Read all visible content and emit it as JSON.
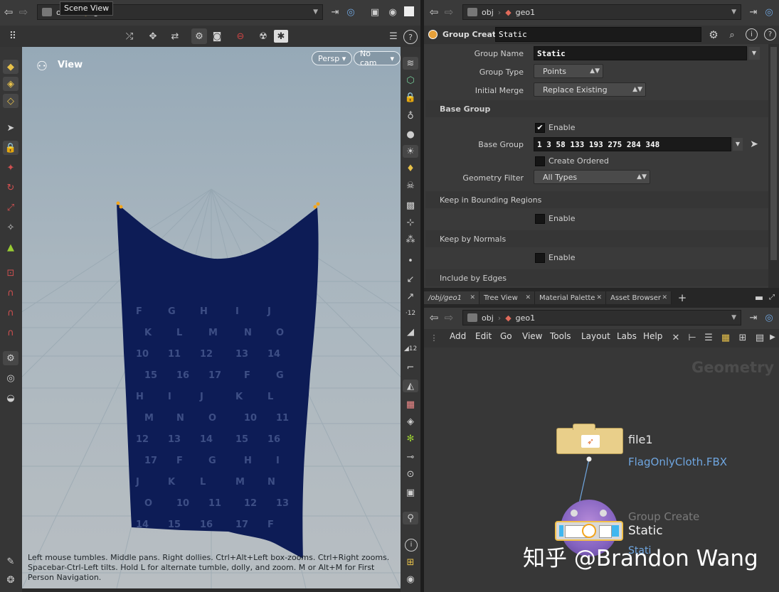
{
  "tooltip": "Scene View",
  "left_path": {
    "node_label": "geo1",
    "truncated_prefix": "o"
  },
  "viewport": {
    "title": "View",
    "persp_label": "Persp",
    "cam_label": "No cam",
    "help_text": "Left mouse tumbles. Middle pans. Right dollies. Ctrl+Alt+Left box-zooms. Ctrl+Right zooms. Spacebar-Ctrl-Left tilts. Hold L for alternate tumble, dolly, and zoom. M or Alt+M for First Person Navigation.",
    "flag_letters": [
      "F",
      "G",
      "H",
      "I",
      "J",
      "K",
      "L",
      "M",
      "N",
      "O",
      "10",
      "11",
      "12",
      "13",
      "14",
      "15",
      "16",
      "17"
    ]
  },
  "top_path": {
    "root": "obj",
    "node": "geo1"
  },
  "params": {
    "node_type": "Group Create",
    "node_name": "Static",
    "group_name_label": "Group Name",
    "group_name_value": "Static",
    "group_type_label": "Group Type",
    "group_type_value": "Points",
    "initial_merge_label": "Initial Merge",
    "initial_merge_value": "Replace Existing",
    "base_group_section": "Base Group",
    "enable_label": "Enable",
    "base_group_label": "Base Group",
    "base_group_value": "1 3 58 133 193 275 284 348",
    "create_ordered_label": "Create Ordered",
    "geometry_filter_label": "Geometry Filter",
    "geometry_filter_value": "All Types",
    "keep_bounding_section": "Keep in Bounding Regions",
    "keep_bounding_enable": "Enable",
    "keep_normals_section": "Keep by Normals",
    "keep_normals_enable": "Enable",
    "include_edges_section": "Include by Edges"
  },
  "tabs": [
    {
      "label": "/obj/geo1"
    },
    {
      "label": "Tree View"
    },
    {
      "label": "Material Palette"
    },
    {
      "label": "Asset Browser"
    }
  ],
  "network_path": {
    "root": "obj",
    "node": "geo1"
  },
  "network_menu": [
    "Add",
    "Edit",
    "Go",
    "View",
    "Tools",
    "Layout",
    "Labs",
    "Help"
  ],
  "network": {
    "context_label": "Geometry",
    "file_node_name": "file1",
    "file_node_file": "FlagOnlyCloth.FBX",
    "group_node_type": "Group Create",
    "group_node_name": "Static",
    "group_node_sub": "Stati"
  },
  "watermark": "知乎 @Brandon Wang",
  "colors": {
    "flag_navy": "#0d1c56",
    "link_blue": "#6fa6e0",
    "selection_cyan": "#3fb7f0"
  }
}
